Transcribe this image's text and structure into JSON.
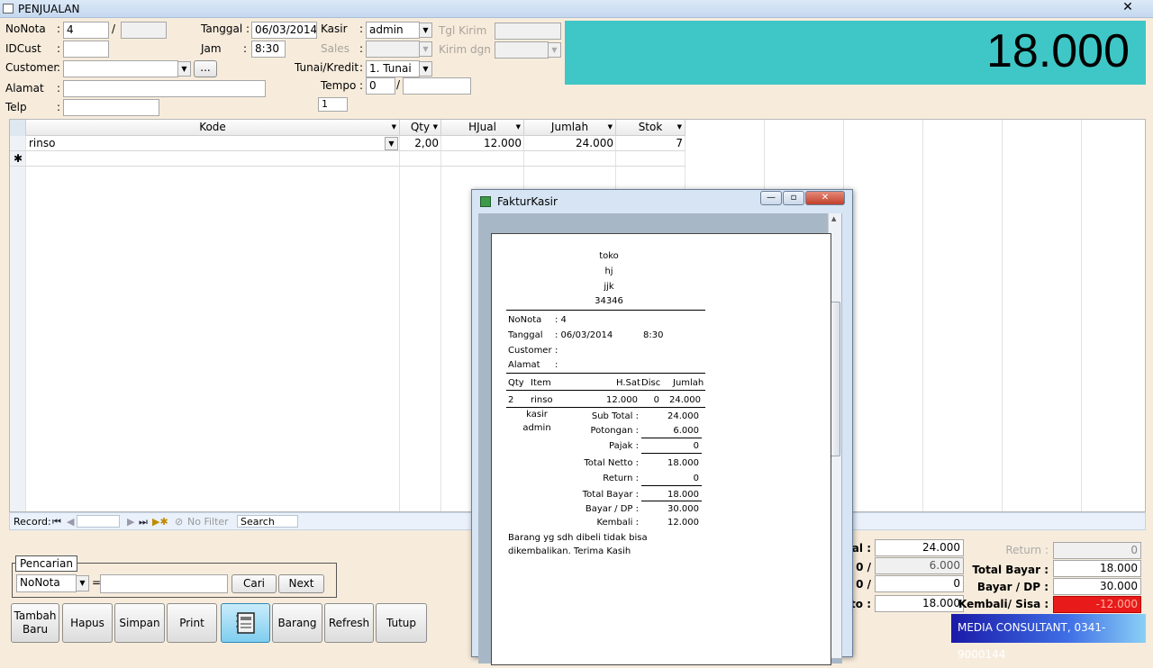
{
  "window": {
    "title": "PENJUALAN",
    "close": "✕"
  },
  "form": {
    "nonota": {
      "label": "NoNota",
      "value": "4",
      "slash": "/",
      "value2": ""
    },
    "idcust": {
      "label": "IDCust",
      "value": ""
    },
    "customer": {
      "label": "Customer",
      "value": "",
      "ellipsis": "..."
    },
    "alamat": {
      "label": "Alamat",
      "value": ""
    },
    "telp": {
      "label": "Telp",
      "value": ""
    },
    "tanggal": {
      "label": "Tanggal :",
      "value": "06/03/2014"
    },
    "jam": {
      "label": "Jam",
      "value": "8:30"
    },
    "kasir": {
      "label": "Kasir",
      "value": "admin"
    },
    "sales": {
      "label": "Sales",
      "value": ""
    },
    "tunai": {
      "label": "Tunai/Kredit",
      "value": "1. Tunai"
    },
    "tempo": {
      "label": "Tempo",
      "value": "0",
      "slash": "/",
      "value2": ""
    },
    "tgl_kirim": {
      "label": "Tgl Kirim",
      "value": ""
    },
    "kirim_dgn": {
      "label": "Kirim dgn",
      "value": ""
    },
    "small_box": "1",
    "colon": ":"
  },
  "big_total": "18.000",
  "grid": {
    "headers": {
      "kode": "Kode",
      "qty": "Qty",
      "hjual": "HJual",
      "jumlah": "Jumlah",
      "stok": "Stok"
    },
    "row": {
      "kode": "rinso",
      "qty": "2,00",
      "hjual": "12.000",
      "jumlah": "24.000",
      "stok": "7"
    },
    "new_row_marker": "✱"
  },
  "navbar": {
    "record_label": "Record:",
    "first": "⏮",
    "prev": "◀",
    "next": "▶",
    "last": "⏭",
    "new": "▶✱",
    "no_filter": "No Filter",
    "search": "Search"
  },
  "pencarian": {
    "title": "Pencarian",
    "field": "NoNota",
    "equals": "=",
    "value": "",
    "cari": "Cari",
    "next": "Next"
  },
  "buttons": {
    "tambah": "Tambah Baru",
    "hapus": "Hapus",
    "simpan": "Simpan",
    "print": "Print",
    "barang": "Barang",
    "refresh": "Refresh",
    "tutup": "Tutup"
  },
  "totals_left": {
    "total_label_partial": "tal :",
    "total_value": "24.000",
    "pot_label_partial": "0  /",
    "pot_value": "6.000",
    "pajak_label_partial": "0  /",
    "pajak_value": "0",
    "netto_label_partial": "to :",
    "netto_value": "18.000"
  },
  "totals_right": {
    "return_label": "Return :",
    "return_value": "0",
    "total_bayar_label": "Total Bayar :",
    "total_bayar_value": "18.000",
    "bayar_dp_label": "Bayar / DP :",
    "bayar_dp_value": "30.000",
    "kembali_label": "Kembali/ Sisa :",
    "kembali_value": "-12.000"
  },
  "media_bar": "MEDIA CONSULTANT, 0341-9000144",
  "modal": {
    "title": "FakturKasir",
    "controls": {
      "min": "—",
      "max": "▫",
      "close": "✕"
    },
    "receipt": {
      "store": [
        "toko",
        "hj",
        "jjk",
        "34346"
      ],
      "nonota_label": "NoNota",
      "nonota_value": ": 4",
      "tanggal_label": "Tanggal",
      "tanggal_value": ": 06/03/2014",
      "jam_value": "8:30",
      "customer_label": "Customer",
      "customer_value": ":",
      "alamat_label": "Alamat",
      "alamat_value": ":",
      "head_qty": "Qty",
      "head_item": "Item",
      "head_hsat": "H.Sat",
      "head_disc": "Disc",
      "head_jumlah": "Jumlah",
      "item_qty": "2",
      "item_name": "rinso",
      "item_hsat": "12.000",
      "item_disc": "0",
      "item_jumlah": "24.000",
      "kasir_label": "kasir",
      "kasir_name": "admin",
      "subtotal_label": "Sub Total :",
      "subtotal_value": "24.000",
      "potongan_label": "Potongan :",
      "potongan_value": "6.000",
      "pajak_label": "Pajak :",
      "pajak_value": "0",
      "netto_label": "Total Netto :",
      "netto_value": "18.000",
      "return_label": "Return :",
      "return_value": "0",
      "totalbayar_label": "Total Bayar :",
      "totalbayar_value": "18.000",
      "bayar_label": "Bayar / DP :",
      "bayar_value": "30.000",
      "kembali_label": "Kembali :",
      "kembali_value": "12.000",
      "footer1": "Barang yg sdh dibeli tidak bisa",
      "footer2": "dikembalikan. Terima Kasih"
    }
  }
}
